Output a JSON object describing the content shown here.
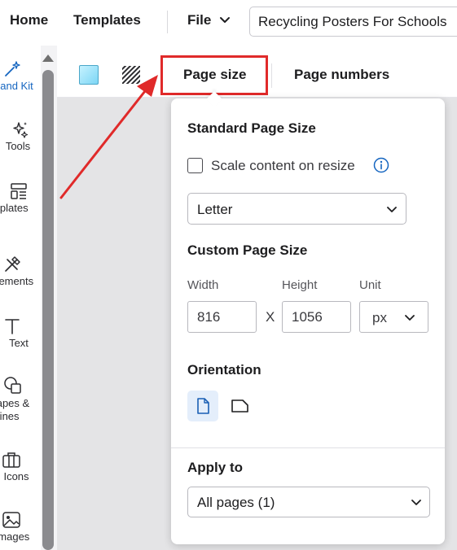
{
  "topbar": {
    "home_label": "Home",
    "templates_label": "Templates",
    "file_label": "File",
    "document_title": "Recycling Posters For Schools"
  },
  "rail": {
    "items": [
      {
        "label": "Brand Kit",
        "icon": "magic-wand-icon"
      },
      {
        "label": "Tools",
        "icon": "sparkles-icon"
      },
      {
        "label": "Templates",
        "icon": "templates-icon"
      },
      {
        "label": "Elements",
        "icon": "elements-icon"
      },
      {
        "label": "Text",
        "icon": "text-icon"
      },
      {
        "label": "Shapes & Lines",
        "icon": "shapes-icon"
      },
      {
        "label": "Icons",
        "icon": "icons-icon"
      },
      {
        "label": "Images",
        "icon": "images-icon"
      }
    ]
  },
  "toolbar": {
    "page_size_tab": "Page size",
    "page_numbers_tab": "Page numbers"
  },
  "popover": {
    "standard_title": "Standard Page Size",
    "scale_label": "Scale content on resize",
    "size_select_value": "Letter",
    "custom_title": "Custom Page Size",
    "width_label": "Width",
    "height_label": "Height",
    "unit_label": "Unit",
    "width_value": "816",
    "height_value": "1056",
    "unit_value": "px",
    "times_symbol": "X",
    "orientation_title": "Orientation",
    "apply_title": "Apply to",
    "apply_value": "All pages (1)"
  },
  "colors": {
    "accent": "#1565c0",
    "annotation_red": "#e02a2a",
    "canvas_gray": "#e4e4e6"
  }
}
